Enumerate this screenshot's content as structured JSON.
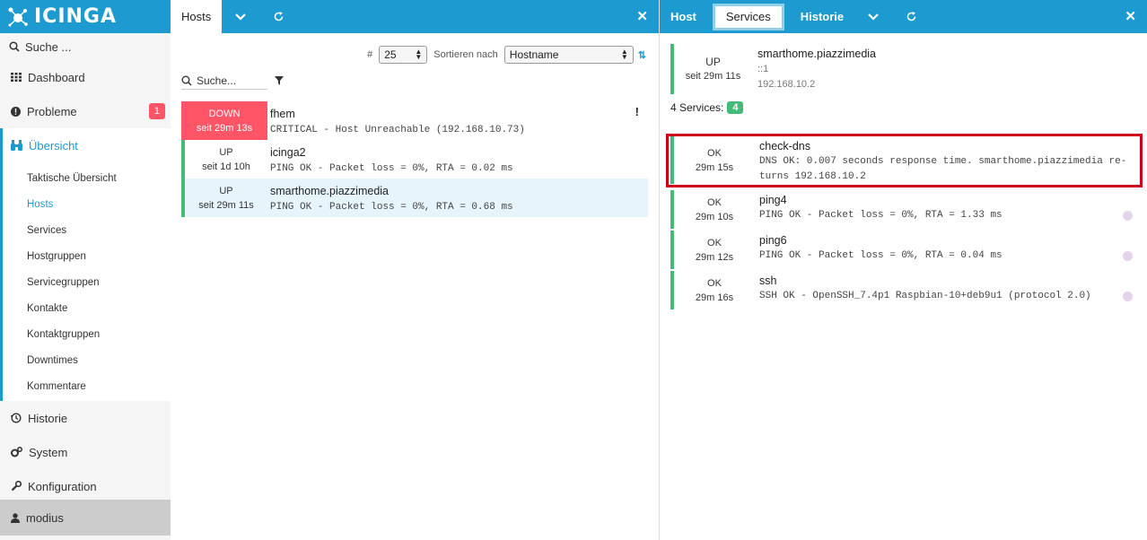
{
  "brand": {
    "logo_text": "icinga"
  },
  "sidebar": {
    "search_placeholder": "Suche ...",
    "items": [
      {
        "label": "Dashboard",
        "icon": "grid-icon"
      },
      {
        "label": "Probleme",
        "icon": "alert-circle-icon",
        "badge": "1"
      },
      {
        "label": "Übersicht",
        "icon": "binoculars-icon"
      }
    ],
    "subitems": [
      "Taktische Übersicht",
      "Hosts",
      "Services",
      "Hostgruppen",
      "Servicegruppen",
      "Kontakte",
      "Kontaktgruppen",
      "Downtimes",
      "Kommentare"
    ],
    "bottom": [
      {
        "label": "Historie",
        "icon": "history-icon"
      },
      {
        "label": "System",
        "icon": "gears-icon"
      },
      {
        "label": "Konfiguration",
        "icon": "wrench-icon"
      }
    ],
    "user": "modius"
  },
  "hosts_pane": {
    "tab": "Hosts",
    "limit_label": "#",
    "limit_value": "25",
    "sort_label": "Sortieren nach",
    "sort_value": "Hostname",
    "search_placeholder": "Suche...",
    "rows": [
      {
        "state": "DOWN",
        "since": "seit 29m 13s",
        "name": "fhem",
        "output": "CRITICAL - Host Unreachable (192.168.10.73)",
        "ack": "!"
      },
      {
        "state": "UP",
        "since": "seit 1d 10h",
        "name": "icinga2",
        "output": "PING OK - Packet loss = 0%, RTA = 0.02 ms"
      },
      {
        "state": "UP",
        "since": "seit 29m 11s",
        "name": "smarthome.piazzimedia",
        "output": "PING OK - Packet loss = 0%, RTA = 0.68 ms"
      }
    ]
  },
  "detail_pane": {
    "tabs": [
      "Host",
      "Services",
      "Historie"
    ],
    "host": {
      "state": "UP",
      "since": "seit 29m 11s",
      "name": "smarthome.piazzimedia",
      "ipv6": "::1",
      "ipv4": "192.168.10.2"
    },
    "services_label": "4 Services:",
    "services_count": "4",
    "services": [
      {
        "state": "OK",
        "since": "29m 15s",
        "name": "check-dns",
        "output": "DNS OK: 0.007 seconds response time. smarthome.piazzimedia re-",
        "output2": "turns 192.168.10.2"
      },
      {
        "state": "OK",
        "since": "29m 10s",
        "name": "ping4",
        "output": "PING OK - Packet loss = 0%, RTA = 1.33 ms"
      },
      {
        "state": "OK",
        "since": "29m 12s",
        "name": "ping6",
        "output": "PING OK - Packet loss = 0%, RTA = 0.04 ms"
      },
      {
        "state": "OK",
        "since": "29m 16s",
        "name": "ssh",
        "output": "SSH OK - OpenSSH_7.4p1 Raspbian-10+deb9u1 (protocol 2.0)"
      }
    ]
  },
  "colors": {
    "accent": "#1d9bd1",
    "critical": "#ff5566",
    "ok": "#44bb77",
    "highlight": "#d0021b"
  }
}
